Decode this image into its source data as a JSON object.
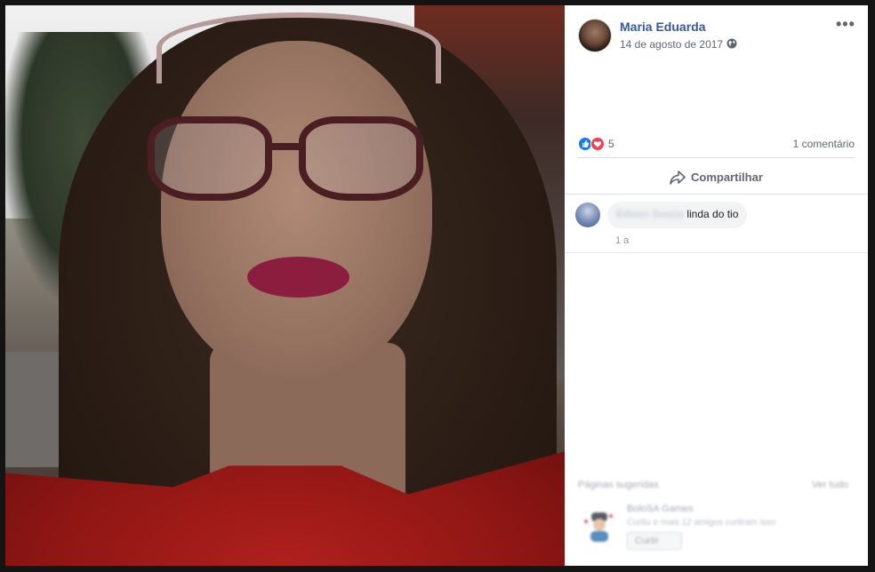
{
  "post": {
    "author": "Maria Eduarda",
    "date": "14 de agosto de 2017",
    "privacy_icon": "globe-icon",
    "more_icon": "more-icon"
  },
  "reactions": {
    "icons": [
      "like-icon",
      "love-icon"
    ],
    "count": "5",
    "comments": "1 comentário"
  },
  "actions": {
    "share_label": "Compartilhar"
  },
  "comment": {
    "author_blurred": "Edson Souza",
    "text": "linda do tio",
    "time": "1 a"
  },
  "suggestions": {
    "title": "Páginas sugeridas",
    "see_all": "Ver tudo",
    "page_name": "BoloSA Games",
    "page_desc": "Curtiu e mais 12 amigos curtiram isso",
    "like_button": "Curtir"
  },
  "colors": {
    "link_blue": "#385898",
    "like_blue": "#1877f2",
    "love_red": "#f33e58",
    "secondary_text": "#606770"
  }
}
